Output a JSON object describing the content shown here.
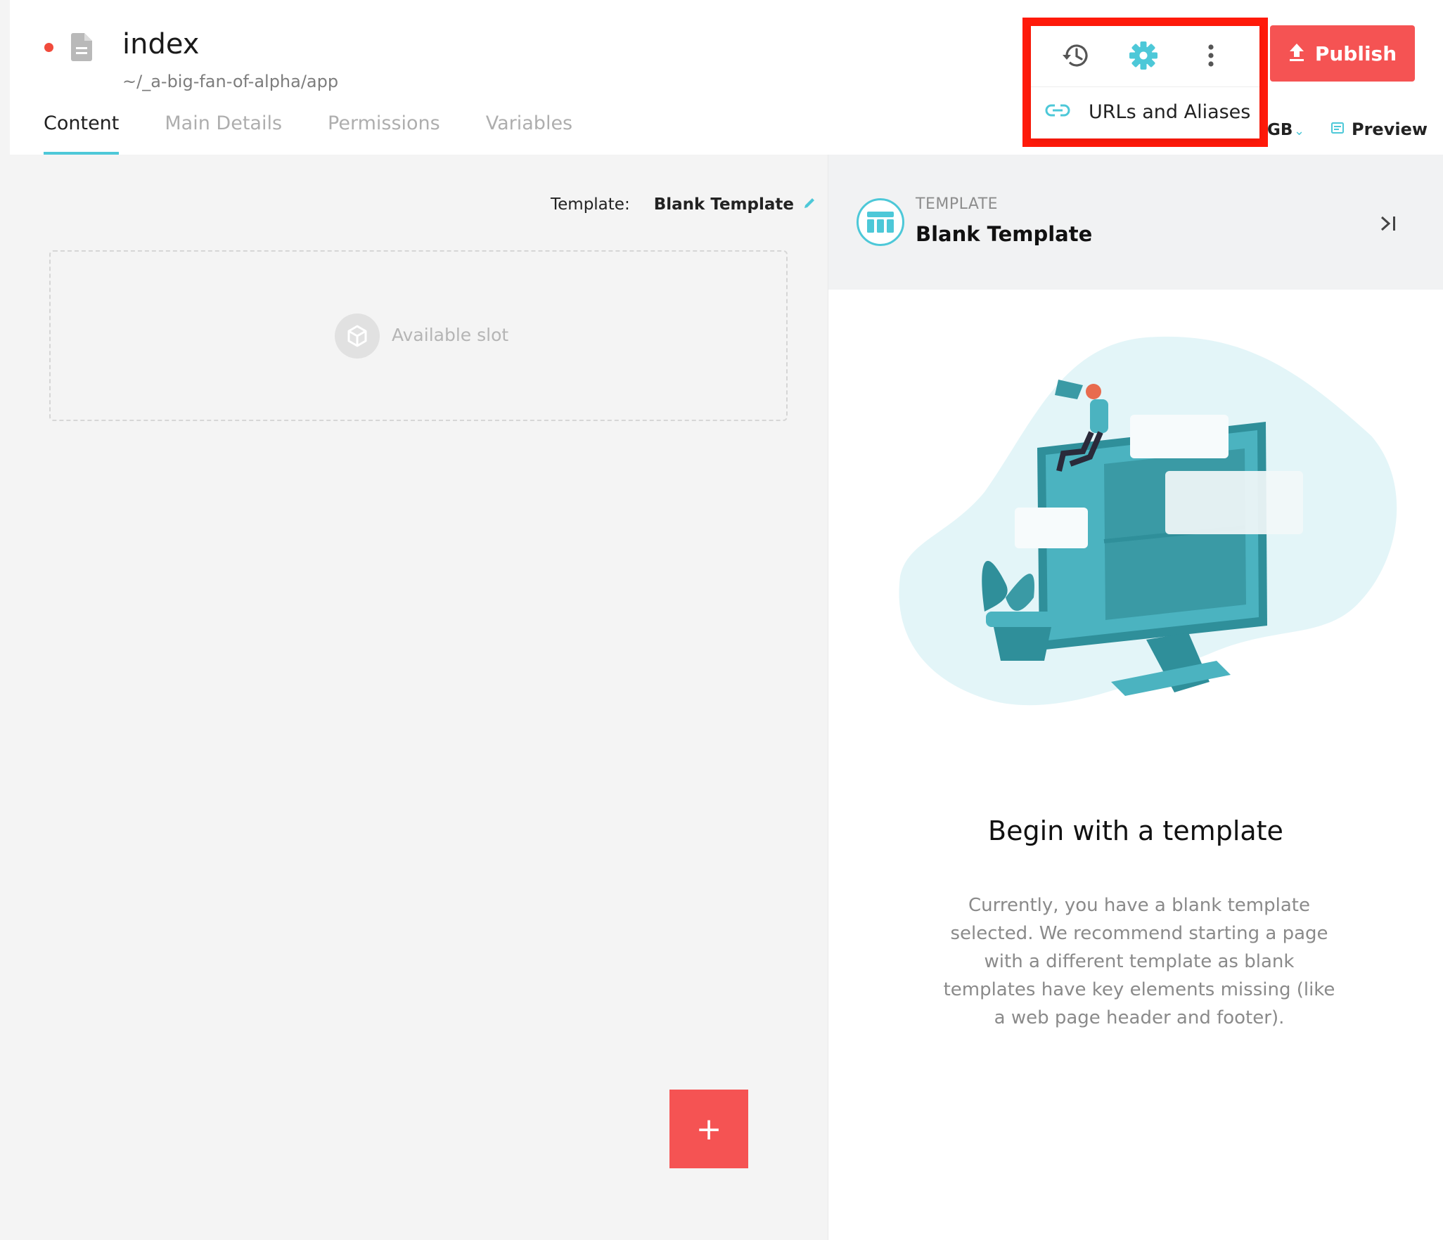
{
  "header": {
    "title": "index",
    "path": "~/_a-big-fan-of-alpha/app",
    "icons": {
      "status": "unsaved-dot",
      "page": "document-icon"
    }
  },
  "tabs": [
    {
      "label": "Content",
      "active": true
    },
    {
      "label": "Main Details",
      "active": false
    },
    {
      "label": "Permissions",
      "active": false
    },
    {
      "label": "Variables",
      "active": false
    }
  ],
  "menu": {
    "icons": [
      "history-icon",
      "gear-icon",
      "more-vertical-icon"
    ],
    "item_label": "URLs and Aliases",
    "item_icon": "link-icon"
  },
  "actions": {
    "publish_label": "Publish",
    "language_fragment": "GB",
    "preview_label": "Preview"
  },
  "canvas": {
    "template_label": "Template:",
    "template_value": "Blank Template",
    "slot_label": "Available slot",
    "add_label": "+"
  },
  "panel": {
    "eyebrow": "TEMPLATE",
    "title": "Blank Template",
    "cta_title": "Begin with a template",
    "cta_body": "Currently, you have a blank template selected. We recommend starting a page with a different template as blank templates have key elements missing (like a web page header and footer)."
  },
  "colors": {
    "accent": "#4dc8d8",
    "publish": "#f55353",
    "highlight": "#ff1a0a",
    "unsaved": "#f14b3c"
  }
}
